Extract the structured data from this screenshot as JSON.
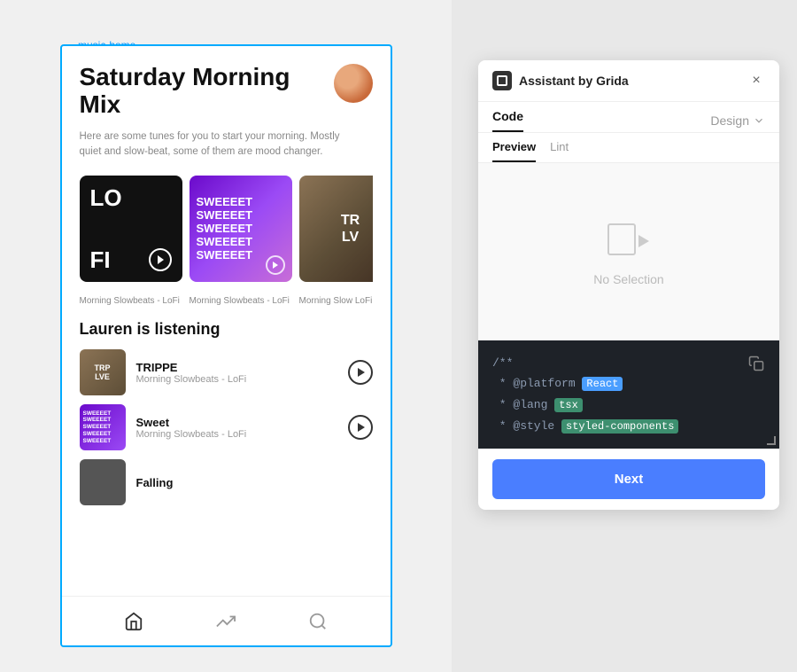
{
  "breadcrumb": {
    "label": "music-home"
  },
  "mobile": {
    "title": "Saturday Morning Mix",
    "subtitle": "Here are some tunes for you to start your morning. Mostly quiet and slow-beat, some of them are mood changer.",
    "cards": [
      {
        "type": "lofi",
        "top_text": "LO",
        "bottom_text": "FI",
        "label": "Morning Slowbeats - LoFi"
      },
      {
        "type": "sweet",
        "text": "SWEEEET SWEEEET SWEEEET SWEEEET SWEEEET",
        "label": "Morning Slowbeats - LoFi"
      },
      {
        "type": "photo",
        "text": "TR\nLV",
        "label": "Morning Slow LoFi"
      }
    ],
    "listening_title": "Lauren is listening",
    "tracks": [
      {
        "name": "TRIPPE",
        "artist": "Morning Slowbeats - LoFi",
        "thumb_type": "trp",
        "thumb_text": "TRP\nLVE"
      },
      {
        "name": "Sweet",
        "artist": "Morning Slowbeats - LoFi",
        "thumb_type": "sweet",
        "thumb_text": "SWEEEET\nSWEEET\nSWEEET\nSWEEET\nSWEEET"
      },
      {
        "name": "Falling",
        "artist": "",
        "thumb_type": "falling"
      }
    ],
    "nav_icons": [
      "home",
      "trending",
      "search"
    ]
  },
  "assistant": {
    "title": "Assistant by Grida",
    "tabs": [
      {
        "label": "Code",
        "active": true
      },
      {
        "label": "Design",
        "active": false
      }
    ],
    "sub_tabs": [
      {
        "label": "Preview",
        "active": true
      },
      {
        "label": "Lint",
        "active": false
      }
    ],
    "no_selection_text": "No Selection",
    "code": {
      "lines": [
        {
          "text": "/**"
        },
        {
          "text": " * @platform ",
          "keyword": "React",
          "keyword_type": "blue"
        },
        {
          "text": " * @lang ",
          "keyword": "tsx",
          "keyword_type": "green"
        },
        {
          "text": " * @style ",
          "keyword": "styled-components",
          "keyword_type": "green"
        }
      ]
    },
    "next_button_label": "Next",
    "close_icon": "×"
  }
}
